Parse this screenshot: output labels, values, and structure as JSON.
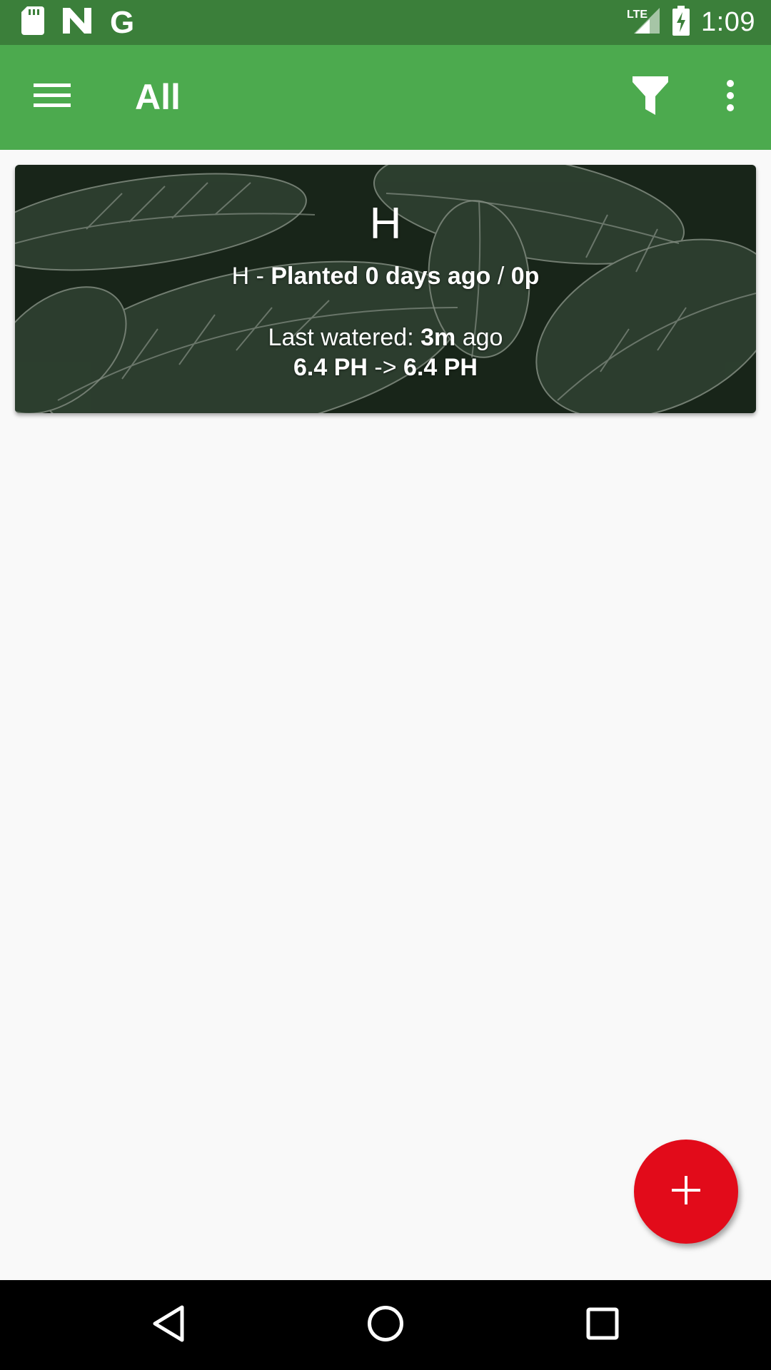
{
  "status_bar": {
    "time": "1:09",
    "network": "LTE",
    "icons": [
      "sd-card-icon",
      "n-notification-icon",
      "google-icon",
      "signal-icon",
      "battery-charging-icon"
    ],
    "google_letter": "G"
  },
  "toolbar": {
    "title": "All",
    "background": "#4caa4e",
    "icons": [
      "menu-icon",
      "filter-icon",
      "more-vert-icon"
    ]
  },
  "plant_card": {
    "name": "H",
    "sub_prefix": "H - ",
    "sub_planted": "Planted 0 days ago",
    "sub_sep": " / ",
    "sub_stage": "0p",
    "watered_prefix": "Last watered: ",
    "watered_time": "3m",
    "watered_suffix": " ago",
    "ph_in": "6.4 PH",
    "ph_arrow": " -> ",
    "ph_out": "6.4 PH"
  },
  "fab": {
    "label": "+",
    "color": "#e20b1a",
    "icon": "add-icon"
  },
  "nav_bar": {
    "icons": [
      "back-icon",
      "home-icon",
      "recents-icon"
    ]
  }
}
